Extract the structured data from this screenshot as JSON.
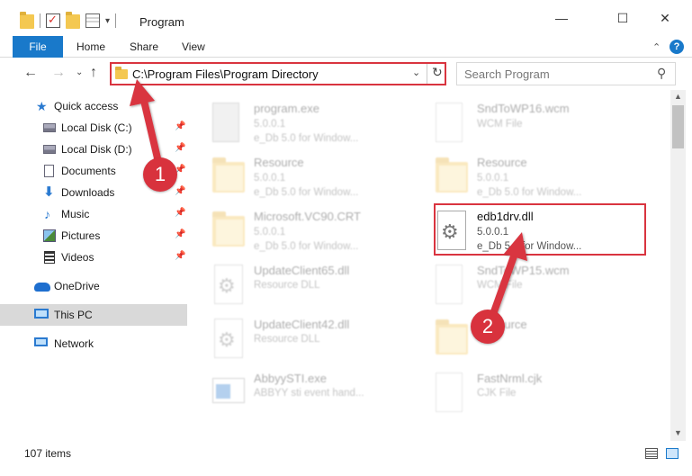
{
  "window": {
    "title": "Program",
    "controls": {
      "minimize": "—",
      "maximize": "☐",
      "close": "✕"
    }
  },
  "ribbon": {
    "tabs": [
      "File",
      "Home",
      "Share",
      "View"
    ],
    "collapse_glyph": "⌃",
    "help_glyph": "?"
  },
  "address": {
    "path": "C:\\Program Files\\Program Directory",
    "dropdown_glyph": "⌄",
    "refresh_glyph": "↻",
    "back_glyph": "←",
    "forward_glyph": "→",
    "recent_glyph": "⌄",
    "up_glyph": "↑"
  },
  "search": {
    "placeholder": "Search Program",
    "icon": "search-icon",
    "glyph": "⚲"
  },
  "sidebar": {
    "items": [
      {
        "label": "Quick access",
        "icon": "star-icon",
        "pinned": false
      },
      {
        "label": "Local Disk (C:)",
        "icon": "disk-icon",
        "pinned": true
      },
      {
        "label": "Local Disk (D:)",
        "icon": "disk-icon",
        "pinned": true
      },
      {
        "label": "Documents",
        "icon": "documents-icon",
        "pinned": true
      },
      {
        "label": "Downloads",
        "icon": "downloads-icon",
        "pinned": true
      },
      {
        "label": "Music",
        "icon": "music-icon",
        "pinned": true
      },
      {
        "label": "Pictures",
        "icon": "pictures-icon",
        "pinned": true
      },
      {
        "label": "Videos",
        "icon": "videos-icon",
        "pinned": true
      },
      {
        "label": "OneDrive",
        "icon": "onedrive-icon",
        "pinned": false
      },
      {
        "label": "This PC",
        "icon": "pc-icon",
        "pinned": false,
        "selected": true
      },
      {
        "label": "Network",
        "icon": "network-icon",
        "pinned": false
      }
    ],
    "pin_glyph": "📌"
  },
  "files": [
    {
      "name": "program.exe",
      "line2": "5.0.0.1",
      "line3": "e_Db 5.0 for Window...",
      "icon": "exe-icon",
      "faded": true
    },
    {
      "name": "SndToWP16.wcm",
      "line2": "WCM File",
      "line3": "",
      "icon": "document-icon",
      "faded": true
    },
    {
      "name": "Resource",
      "line2": "5.0.0.1",
      "line3": "e_Db 5.0 for Window...",
      "icon": "folder-icon",
      "faded": true
    },
    {
      "name": "Resource",
      "line2": "5.0.0.1",
      "line3": "e_Db 5.0 for Window...",
      "icon": "folder-icon",
      "faded": true
    },
    {
      "name": "Microsoft.VC90.CRT",
      "line2": "5.0.0.1",
      "line3": "e_Db 5.0 for Window...",
      "icon": "folder-icon",
      "faded": true
    },
    {
      "name": "edb1drv.dll",
      "line2": "5.0.0.1",
      "line3": "e_Db 5.0 for Window...",
      "icon": "dll-gear-icon",
      "faded": false
    },
    {
      "name": "UpdateClient65.dll",
      "line2": "Resource DLL",
      "line3": "",
      "icon": "dll-gear-icon",
      "faded": true
    },
    {
      "name": "SndToWP15.wcm",
      "line2": "WCM File",
      "line3": "",
      "icon": "document-icon",
      "faded": true
    },
    {
      "name": "UpdateClient42.dll",
      "line2": "Resource DLL",
      "line3": "",
      "icon": "dll-gear-icon",
      "faded": true
    },
    {
      "name": "Resource",
      "line2": "",
      "line3": "",
      "icon": "folder-icon",
      "faded": true
    },
    {
      "name": "AbbyySTI.exe",
      "line2": "ABBYY sti event hand...",
      "line3": "",
      "icon": "app-icon",
      "faded": true
    },
    {
      "name": "FastNrml.cjk",
      "line2": "CJK File",
      "line3": "",
      "icon": "document-icon",
      "faded": true
    }
  ],
  "annotations": {
    "badge1": "1",
    "badge2": "2",
    "color": "#d9343f"
  },
  "status": {
    "item_count": "107 items"
  },
  "colors": {
    "accent": "#1979ca",
    "highlight": "#d9343f",
    "selected_bg": "#d9d9d9"
  }
}
